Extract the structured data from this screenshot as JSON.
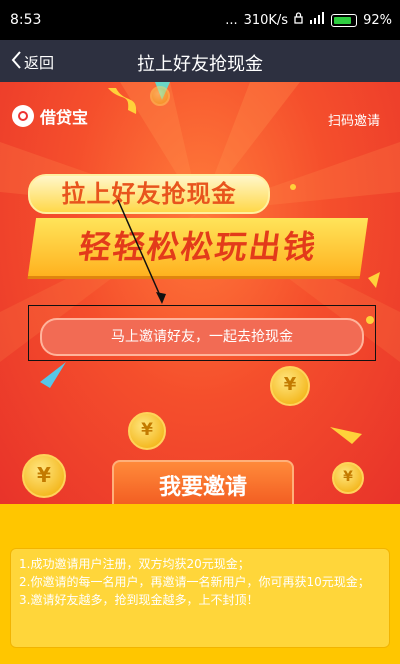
{
  "status_bar": {
    "time": "8:53",
    "signal_dots": "...",
    "speed": "310K/s",
    "battery": "92%"
  },
  "title_bar": {
    "back_label": "返回",
    "title": "拉上好友抢现金"
  },
  "banner": {
    "logo_text": "借贷宝",
    "scan_invite": "扫码邀请",
    "headline": "拉上好友抢现金",
    "slogan": "轻轻松松玩出钱",
    "invite_pill": "马上邀请好友，一起去抢现金",
    "cta": "我要邀请",
    "coin_symbol": "¥"
  },
  "rules": {
    "items": [
      "1.成功邀请用户注册，双方均获20元现金；",
      "2.你邀请的每一名用户，再邀请一名新用户，你可再获10元现金；",
      "3.邀请好友越多，抢到现金越多，上不封顶！"
    ]
  },
  "colors": {
    "status_bg": "#000000",
    "title_bg": "#2d3040",
    "banner_red": "#f54f2c",
    "bottom_yellow": "#ffc600",
    "battery_green": "#2ecc40"
  }
}
